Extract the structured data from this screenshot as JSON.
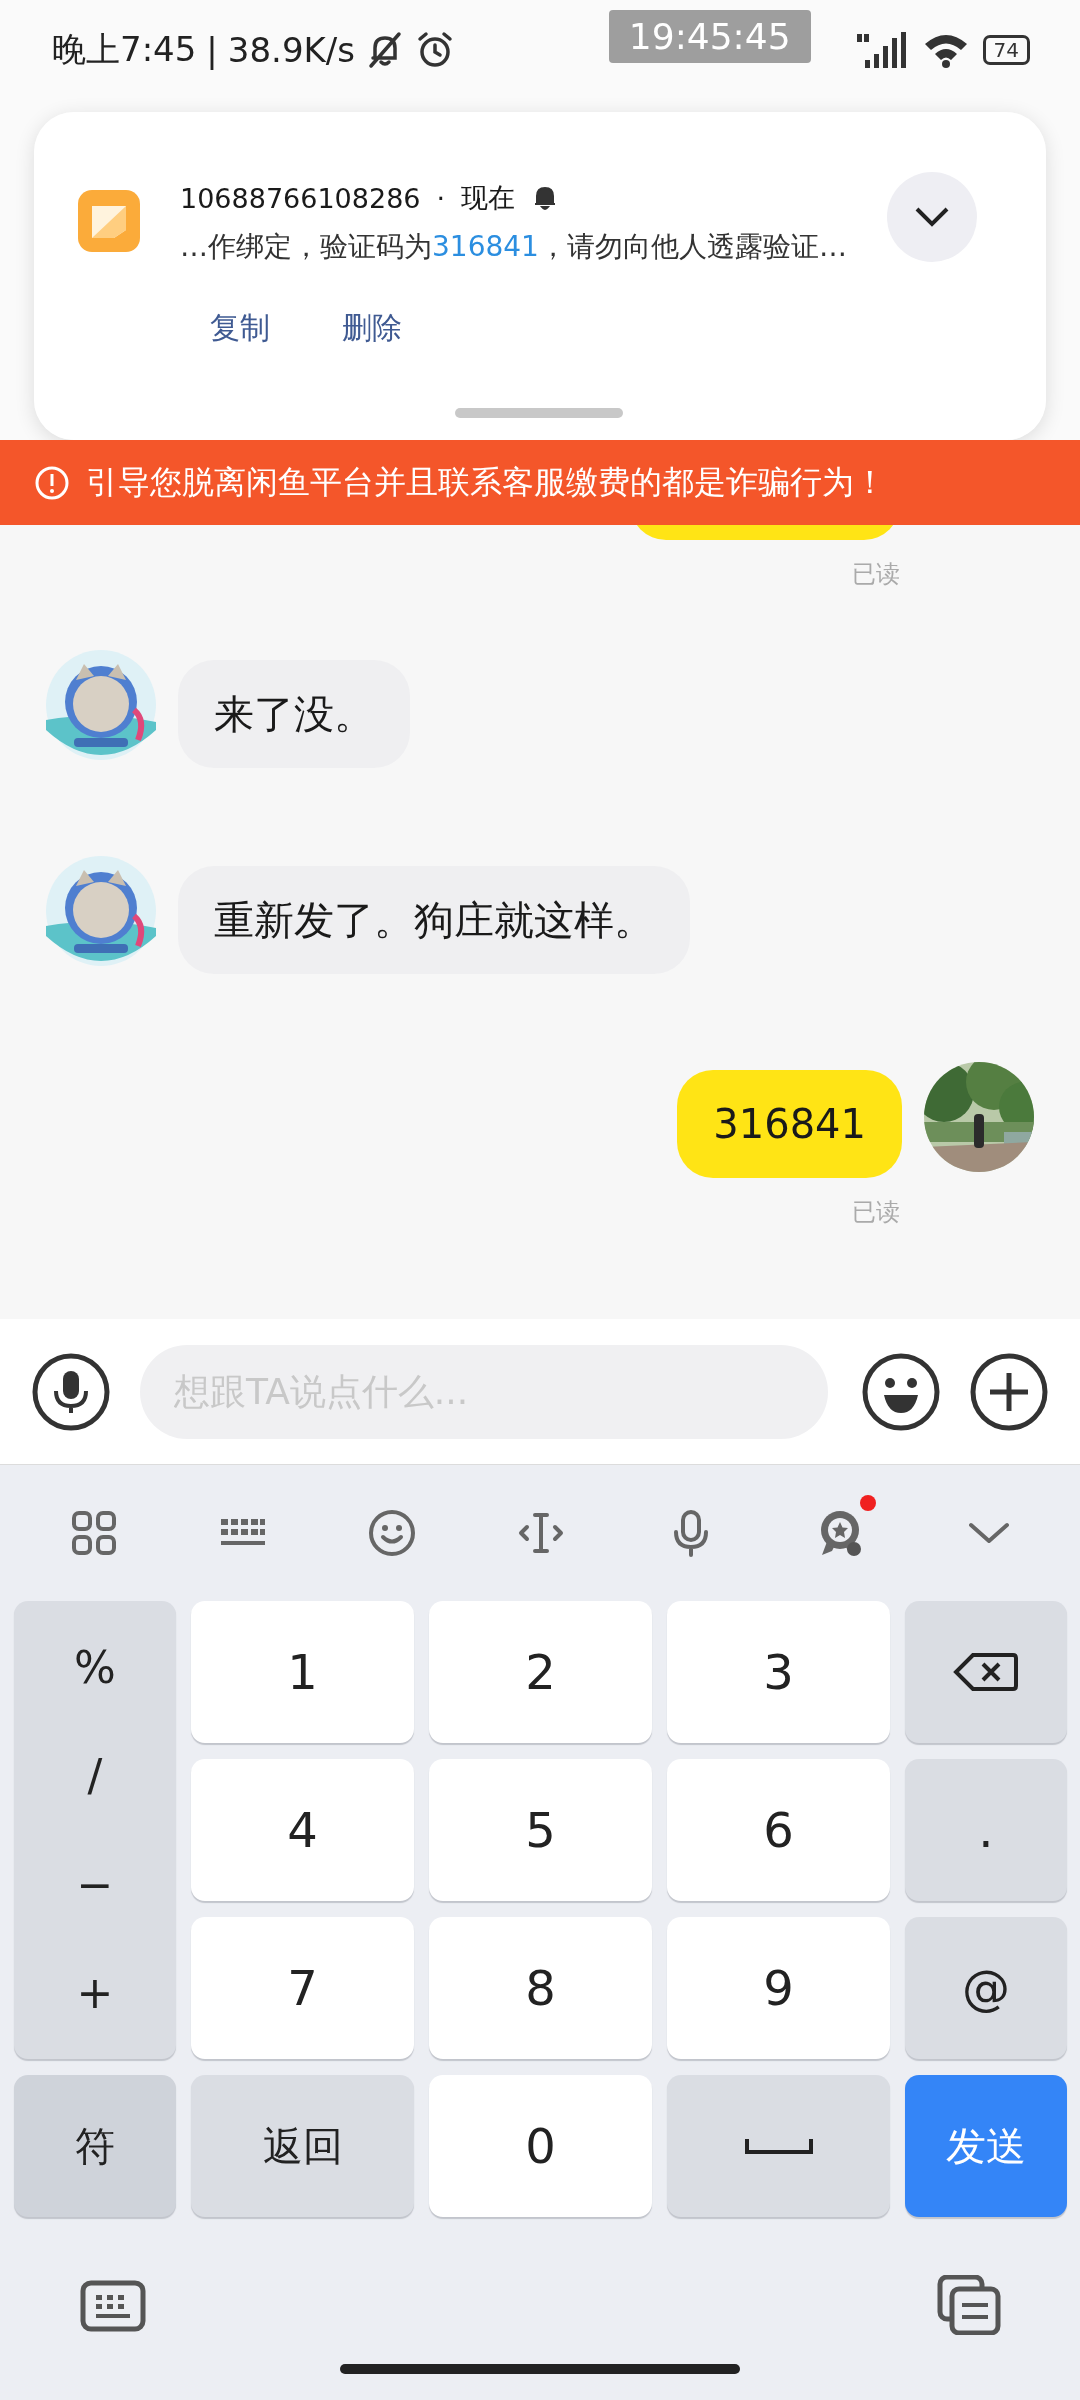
{
  "status_bar": {
    "time": "晚上7:45",
    "separator": "|",
    "speed": "38.9K/s",
    "clock_overlay": "19:45:45",
    "battery": "74"
  },
  "notification": {
    "sender": "10688766108286",
    "dot": "·",
    "time": "现在",
    "message": [
      {
        "kind": "plain",
        "text": "…作绑定，验证码为"
      },
      {
        "kind": "code",
        "text": "316841"
      },
      {
        "kind": "plain",
        "text": "，请勿向他人透露验证…"
      }
    ],
    "actions": [
      "复制",
      "删除"
    ]
  },
  "warning_banner": {
    "text": "引导您脱离闲鱼平台并且联系客服缴费的都是诈骗行为！"
  },
  "messages": [
    {
      "kind": "outgoing",
      "clipped": true,
      "read_receipt": "已读"
    },
    {
      "kind": "incoming",
      "clipped": false,
      "text": "来了没。"
    },
    {
      "kind": "incoming",
      "clipped": false,
      "text": "重新发了。狗庄就这样。"
    },
    {
      "kind": "outgoing",
      "clipped": false,
      "text": "316841",
      "read_receipt": "已读"
    }
  ],
  "composer": {
    "placeholder": "想跟TA说点什么..."
  },
  "keyboard": {
    "toolbar": [
      {
        "kind": "apps",
        "dot": false
      },
      {
        "kind": "keyboard",
        "dot": false
      },
      {
        "kind": "emoji",
        "dot": false
      },
      {
        "kind": "cursor",
        "dot": false
      },
      {
        "kind": "voice",
        "dot": false
      },
      {
        "kind": "award",
        "dot": true
      },
      {
        "kind": "collapse",
        "dot": false
      }
    ],
    "symbols": [
      "%",
      "/",
      "−",
      "+"
    ],
    "keys": [
      {
        "kind": "digit",
        "label": "1"
      },
      {
        "kind": "digit",
        "label": "2"
      },
      {
        "kind": "digit",
        "label": "3"
      },
      {
        "kind": "backspace"
      },
      {
        "kind": "digit",
        "label": "4"
      },
      {
        "kind": "digit",
        "label": "5"
      },
      {
        "kind": "digit",
        "label": "6"
      },
      {
        "kind": "function",
        "label": "."
      },
      {
        "kind": "digit",
        "label": "7"
      },
      {
        "kind": "digit",
        "label": "8"
      },
      {
        "kind": "digit",
        "label": "9"
      },
      {
        "kind": "function",
        "label": "@"
      },
      {
        "kind": "mode",
        "label": "符"
      },
      {
        "kind": "function",
        "label": "返回"
      },
      {
        "kind": "digit",
        "label": "0"
      },
      {
        "kind": "space"
      },
      {
        "kind": "send",
        "label": "发送"
      }
    ]
  }
}
